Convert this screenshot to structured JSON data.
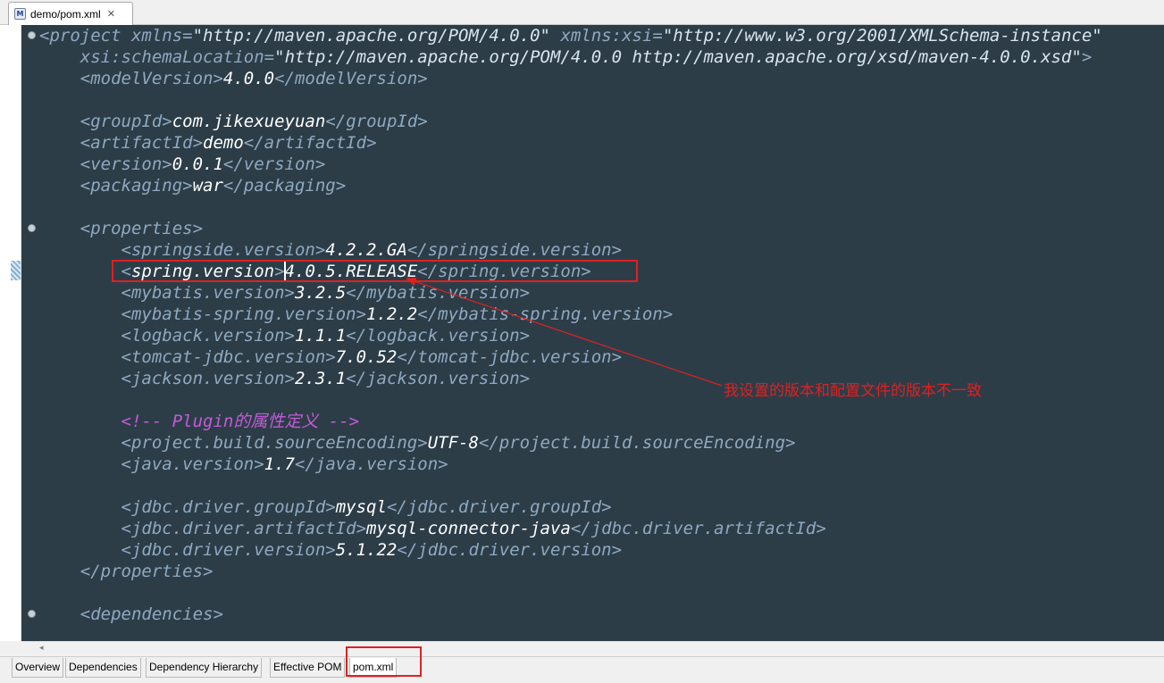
{
  "editor_tab": {
    "icon": "M",
    "title": "demo/pom.xml",
    "close": "✕"
  },
  "lines": [
    [
      [
        "tag",
        "<project "
      ],
      [
        "aname",
        "xmlns"
      ],
      [
        "tag",
        "="
      ],
      [
        "aval",
        "\"http://maven.apache.org/POM/4.0.0\""
      ],
      [
        "tag",
        " "
      ],
      [
        "aname",
        "xmlns:xsi"
      ],
      [
        "tag",
        "="
      ],
      [
        "aval",
        "\"http://www.w3.org/2001/XMLSchema-instance\""
      ]
    ],
    [
      [
        "tag",
        "    "
      ],
      [
        "aname",
        "xsi:schemaLocation"
      ],
      [
        "tag",
        "="
      ],
      [
        "aval",
        "\"http://maven.apache.org/POM/4.0.0 http://maven.apache.org/xsd/maven-4.0.0.xsd\""
      ],
      [
        "tag",
        ">"
      ]
    ],
    [
      [
        "tag",
        "    <modelVersion>"
      ],
      [
        "txt",
        "4.0.0"
      ],
      [
        "tag",
        "</modelVersion>"
      ]
    ],
    [],
    [
      [
        "tag",
        "    <groupId>"
      ],
      [
        "txt",
        "com.jikexueyuan"
      ],
      [
        "tag",
        "</groupId>"
      ]
    ],
    [
      [
        "tag",
        "    <artifactId>"
      ],
      [
        "txt",
        "demo"
      ],
      [
        "tag",
        "</artifactId>"
      ]
    ],
    [
      [
        "tag",
        "    <version>"
      ],
      [
        "txt",
        "0.0.1"
      ],
      [
        "tag",
        "</version>"
      ]
    ],
    [
      [
        "tag",
        "    <packaging>"
      ],
      [
        "txt",
        "war"
      ],
      [
        "tag",
        "</packaging>"
      ]
    ],
    [],
    [
      [
        "tag",
        "    <properties>"
      ]
    ],
    [
      [
        "tag",
        "        <springside.version>"
      ],
      [
        "txt",
        "4.2.2.GA"
      ],
      [
        "tag",
        "</springside.version>"
      ]
    ],
    [
      [
        "tag",
        "        <"
      ],
      [
        "txt",
        "spring.version"
      ],
      [
        "tag",
        ">"
      ],
      [
        "txt",
        "4.0.5.RELEASE"
      ],
      [
        "tag",
        "</spring.version>"
      ]
    ],
    [
      [
        "tag",
        "        <mybatis.version>"
      ],
      [
        "txt",
        "3.2.5"
      ],
      [
        "tag",
        "</mybatis.version>"
      ]
    ],
    [
      [
        "tag",
        "        <mybatis-spring.version>"
      ],
      [
        "txt",
        "1.2.2"
      ],
      [
        "tag",
        "</mybatis-spring.version>"
      ]
    ],
    [
      [
        "tag",
        "        <logback.version>"
      ],
      [
        "txt",
        "1.1.1"
      ],
      [
        "tag",
        "</logback.version>"
      ]
    ],
    [
      [
        "tag",
        "        <tomcat-jdbc.version>"
      ],
      [
        "txt",
        "7.0.52"
      ],
      [
        "tag",
        "</tomcat-jdbc.version>"
      ]
    ],
    [
      [
        "tag",
        "        <jackson.version>"
      ],
      [
        "txt",
        "2.3.1"
      ],
      [
        "tag",
        "</jackson.version>"
      ]
    ],
    [],
    [
      [
        "cm",
        "        <!-- Plugin的属性定义 -->"
      ]
    ],
    [
      [
        "tag",
        "        <project.build.sourceEncoding>"
      ],
      [
        "txt",
        "UTF-8"
      ],
      [
        "tag",
        "</project.build.sourceEncoding>"
      ]
    ],
    [
      [
        "tag",
        "        <java.version>"
      ],
      [
        "txt",
        "1.7"
      ],
      [
        "tag",
        "</java.version>"
      ]
    ],
    [],
    [
      [
        "tag",
        "        <jdbc.driver.groupId>"
      ],
      [
        "txt",
        "mysql"
      ],
      [
        "tag",
        "</jdbc.driver.groupId>"
      ]
    ],
    [
      [
        "tag",
        "        <jdbc.driver.artifactId>"
      ],
      [
        "txt",
        "mysql-connector-java"
      ],
      [
        "tag",
        "</jdbc.driver.artifactId>"
      ]
    ],
    [
      [
        "tag",
        "        <jdbc.driver.version>"
      ],
      [
        "txt",
        "5.1.22"
      ],
      [
        "tag",
        "</jdbc.driver.version>"
      ]
    ],
    [
      [
        "tag",
        "    </properties>"
      ]
    ],
    [],
    [
      [
        "tag",
        "    <dependencies>"
      ]
    ]
  ],
  "annotation": "我设置的版本和配置文件的版本不一致",
  "scroll_left": "◂",
  "bottom_tabs": [
    {
      "label": "Overview",
      "active": false
    },
    {
      "label": "Dependencies",
      "active": false
    },
    {
      "label": "Dependency Hierarchy",
      "active": false
    },
    {
      "label": "Effective POM",
      "active": false
    },
    {
      "label": "pom.xml",
      "active": true
    }
  ],
  "colors": {
    "editor_bg": "#2c3d48",
    "tag": "#8fa9c0",
    "text": "#ffffff",
    "comment": "#c45ad7",
    "annotation": "#e02020"
  }
}
